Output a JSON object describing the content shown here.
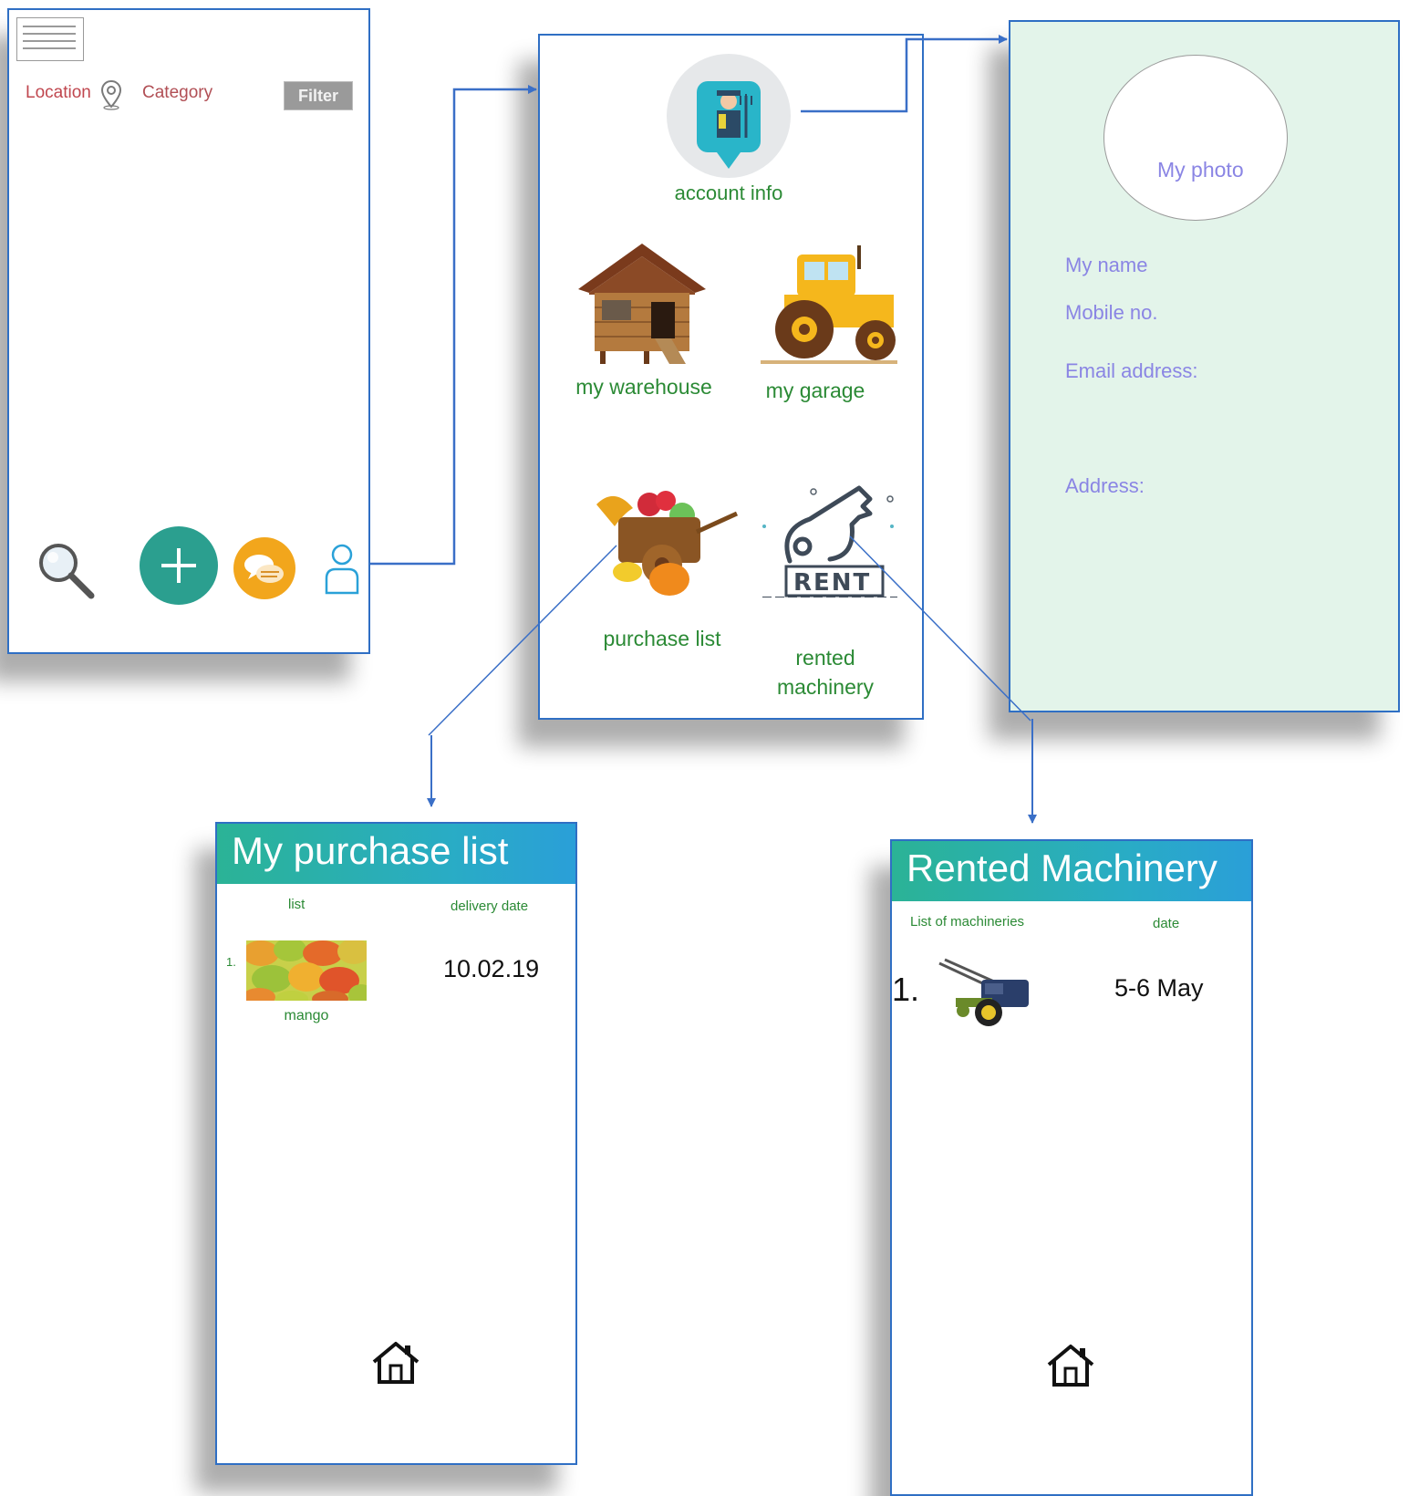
{
  "screens": {
    "home": {
      "location_label": "Location",
      "category_label": "Category",
      "filter_label": "Filter"
    },
    "menu": {
      "account_info": "account info",
      "my_warehouse": "my warehouse",
      "my_garage": "my garage",
      "purchase_list": "purchase list",
      "rented_line1": "rented",
      "rented_line2": "machinery",
      "rent_sign": "RENT"
    },
    "account": {
      "photo_label": "My photo",
      "name_label": "My name",
      "mobile_label": "Mobile no.",
      "email_label": "Email address:",
      "address_label": "Address:"
    },
    "purchase": {
      "title": "My purchase list",
      "col_list": "list",
      "col_date": "delivery date",
      "items": [
        {
          "index": "1.",
          "name": "mango",
          "date": "10.02.19"
        }
      ]
    },
    "rented": {
      "title": "Rented Machinery",
      "col_list": "List of machineries",
      "col_date": "date",
      "items": [
        {
          "index": "1.",
          "date": "5-6 May"
        }
      ]
    }
  },
  "colors": {
    "frame_border": "#2f6fc4",
    "arrow": "#3a6fc7",
    "menu_text": "#2b8a35",
    "account_bg": "#e3f4ea",
    "account_text": "#8a85e4",
    "header_gradient_start": "#2bb396",
    "header_gradient_end": "#2a9fd8",
    "accent_teal": "#2b9f8f",
    "accent_orange": "#f2a61c",
    "location_text": "#c0474f"
  },
  "icons": [
    "menu-icon",
    "location-pin-icon",
    "search-icon",
    "add-icon",
    "chat-icon",
    "user-icon",
    "farmer-icon",
    "warehouse-icon",
    "tractor-icon",
    "produce-cart-icon",
    "rent-key-icon",
    "mango-image",
    "power-tiller-image",
    "home-icon"
  ]
}
